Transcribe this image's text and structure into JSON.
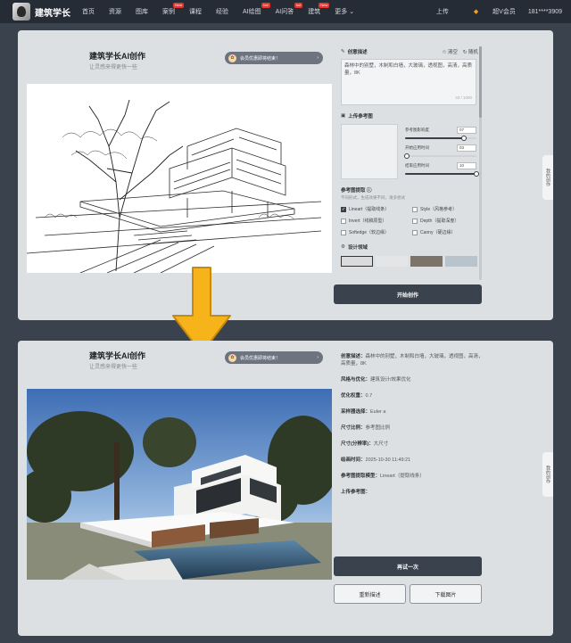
{
  "nav": {
    "logo_text": "建筑学长",
    "items": [
      {
        "label": "首页",
        "badge": ""
      },
      {
        "label": "资源",
        "badge": ""
      },
      {
        "label": "图库",
        "badge": ""
      },
      {
        "label": "案例",
        "badge": "New"
      },
      {
        "label": "课程",
        "badge": ""
      },
      {
        "label": "经验",
        "badge": ""
      },
      {
        "label": "AI绘图",
        "badge": "hot"
      },
      {
        "label": "AI问答",
        "badge": "hot"
      },
      {
        "label": "建筑",
        "badge": "New"
      },
      {
        "label": "更多 ⌄",
        "badge": ""
      }
    ],
    "upload": "上传",
    "vip": "超V会员",
    "phone": "181****3909"
  },
  "top_panel": {
    "title": "建筑学长AI创作",
    "subtitle": "让灵感来得更快一些",
    "promo": "会员优惠即将结束！",
    "desc_label": "创意描述",
    "clear_label": "清空",
    "random_label": "随机",
    "prompt": "森林中的别墅，木制和白墙，大玻璃，透视图，高清，高质量，8K",
    "counter": "33 / 1000",
    "ref_label": "上传参考图",
    "slider1_label": "参考图影响度",
    "slider1_value": "07",
    "slider1_level": 0.82,
    "slider2_label": "开始应用时间",
    "slider2_value": "03",
    "slider2_level": 0.02,
    "slider3_label": "结束应用时间",
    "slider3_value": "10",
    "slider3_level": 1.0,
    "extract_label": "参考图提取 ⓘ",
    "extract_hint": "不同形式，生成效果不同，请多尝试",
    "options": [
      {
        "label": "Lineart（提取线条）",
        "checked": true
      },
      {
        "label": "Style（风格参考）",
        "checked": false
      },
      {
        "label": "Invert（线稿原型）",
        "checked": false
      },
      {
        "label": "Depth（提取深度）",
        "checked": false
      },
      {
        "label": "Softedge（软边缘）",
        "checked": false
      },
      {
        "label": "Canny（硬边缘）",
        "checked": false
      }
    ],
    "design_label": "设计领域",
    "start_button": "开始创作",
    "side_tab": "我的创作"
  },
  "bottom_panel": {
    "title": "建筑学长AI创作",
    "subtitle": "让灵感来得更快一些",
    "promo": "会员优惠即将结束！",
    "info": [
      {
        "key": "创意描述：",
        "value": "森林中的别墅，木制和白墙，大玻璃，透视图，高清，高质量，8K"
      },
      {
        "key": "风格与优化：",
        "value": "建筑设计/效果优化"
      },
      {
        "key": "优化权重：",
        "value": "0.7"
      },
      {
        "key": "采样器选择：",
        "value": "Euler a"
      },
      {
        "key": "尺寸比例：",
        "value": "参考图比例"
      },
      {
        "key": "尺寸(分辨率)：",
        "value": "大尺寸"
      },
      {
        "key": "绘画时间：",
        "value": "2025-10-30 11:49:21"
      },
      {
        "key": "参考图提取模型：",
        "value": "Lineart（提取线条）"
      },
      {
        "key": "上传参考图：",
        "value": ""
      }
    ],
    "retry_button": "再试一次",
    "redescribe_button": "重新描述",
    "download_button": "下载图片",
    "side_tab": "我的创作"
  }
}
